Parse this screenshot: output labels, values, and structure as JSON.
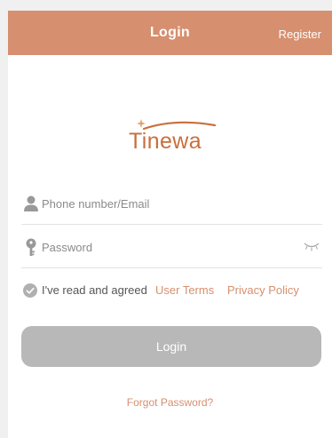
{
  "header": {
    "title": "Login",
    "register_label": "Register"
  },
  "logo": {
    "text": "Tinewa"
  },
  "form": {
    "phone_placeholder": "Phone number/Email",
    "password_placeholder": "Password"
  },
  "agreement": {
    "text": "I've read and agreed",
    "terms_label": "User Terms",
    "privacy_label": "Privacy Policy"
  },
  "login_button_label": "Login",
  "forgot_label": "Forgot Password?",
  "icons": {
    "phone_field": "person-icon",
    "password_field": "key-icon",
    "password_toggle": "eye-closed-icon",
    "agreement": "check-circle-icon"
  },
  "colors": {
    "accent": "#d68f6f",
    "logo": "#c86f3c",
    "button_disabled": "#b8b8b8"
  }
}
